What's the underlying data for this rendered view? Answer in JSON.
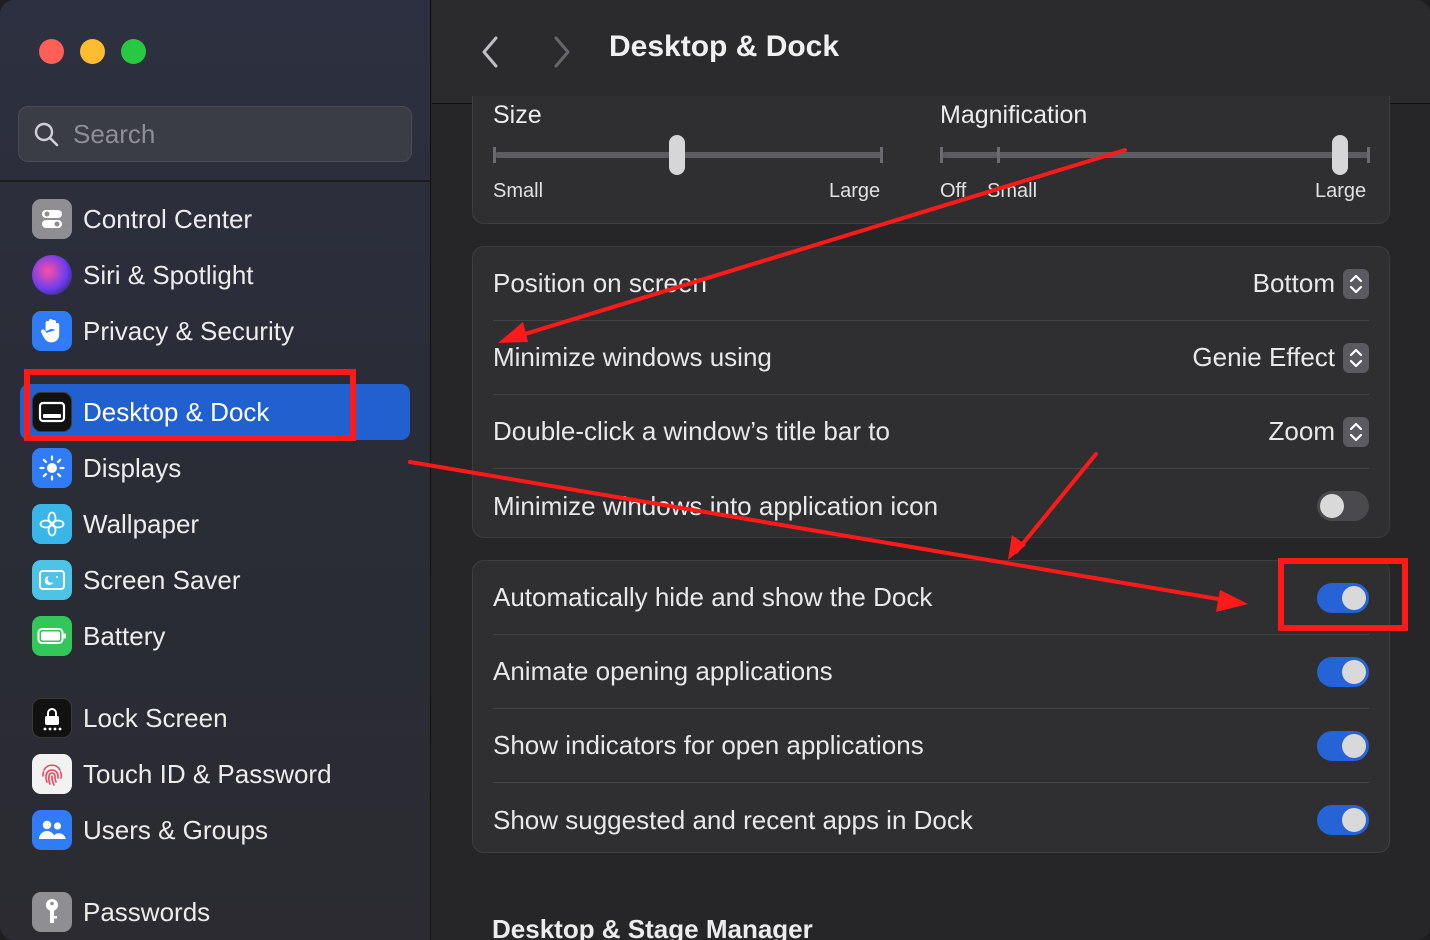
{
  "window": {
    "title": "Desktop & Dock",
    "traffic_lights": [
      "close",
      "minimize",
      "zoom"
    ]
  },
  "sidebar": {
    "search": {
      "placeholder": "Search",
      "value": ""
    },
    "items": [
      {
        "label": "Control Center",
        "icon": "control-center-icon",
        "color": "#8e8e93"
      },
      {
        "label": "Siri & Spotlight",
        "icon": "siri-icon",
        "color": "#7a3fd6"
      },
      {
        "label": "Privacy & Security",
        "icon": "hand-icon",
        "color": "#2f7cf6"
      },
      {
        "label": "Desktop & Dock",
        "icon": "dock-icon",
        "color": "#111111",
        "active": true
      },
      {
        "label": "Displays",
        "icon": "sun-icon",
        "color": "#2f7cf6"
      },
      {
        "label": "Wallpaper",
        "icon": "flower-icon",
        "color": "#39b6e8"
      },
      {
        "label": "Screen Saver",
        "icon": "screen-saver-icon",
        "color": "#4fc3e6"
      },
      {
        "label": "Battery",
        "icon": "battery-icon",
        "color": "#33c759"
      },
      {
        "label": "Lock Screen",
        "icon": "lock-icon",
        "color": "#111111"
      },
      {
        "label": "Touch ID & Password",
        "icon": "fingerprint-icon",
        "color": "#f2f2f2"
      },
      {
        "label": "Users & Groups",
        "icon": "users-icon",
        "color": "#2f7cf6"
      },
      {
        "label": "Passwords",
        "icon": "key-icon",
        "color": "#8e8e93"
      }
    ]
  },
  "main": {
    "size_slider": {
      "label": "Size",
      "min_label": "Small",
      "max_label": "Large",
      "value": 0.47
    },
    "magnification_slider": {
      "label": "Magnification",
      "off_label": "Off",
      "min_label": "Small",
      "max_label": "Large",
      "value": 0.93
    },
    "dock_settings": [
      {
        "label": "Position on screen",
        "value": "Bottom"
      },
      {
        "label": "Minimize windows using",
        "value": "Genie Effect"
      },
      {
        "label": "Double-click a window’s title bar to",
        "value": "Zoom"
      },
      {
        "label": "Minimize windows into application icon",
        "toggle": false
      }
    ],
    "dock_toggles": [
      {
        "label": "Automatically hide and show the Dock",
        "toggle": true
      },
      {
        "label": "Animate opening applications",
        "toggle": true
      },
      {
        "label": "Show indicators for open applications",
        "toggle": true
      },
      {
        "label": "Show suggested and recent apps in Dock",
        "toggle": true
      }
    ],
    "next_section": "Desktop & Stage Manager"
  },
  "annotations": {
    "color": "#ff1a1a"
  }
}
